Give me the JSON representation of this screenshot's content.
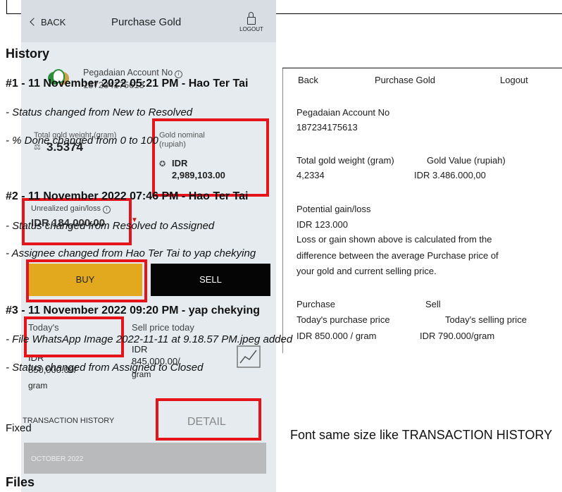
{
  "history_title": "History",
  "files_title": "Files",
  "fixed_note": "Fixed",
  "journal": [
    {
      "header": "#1 - 11 November 2022 05:21 PM - Hao Ter Tai",
      "details": [
        "- Status changed from New to Resolved",
        "- % Done changed from 0 to 100"
      ]
    },
    {
      "header": "#2 - 11 November 2022 07:46 PM - Hao Ter Tai",
      "details": [
        "- Status changed from Resolved to Assigned",
        "- Assignee changed from Hao Ter Tai to yap chekying"
      ]
    },
    {
      "header": "#3 - 11 November 2022 09:20 PM - yap chekying",
      "details": [
        "- File WhatsApp Image 2022-11-11 at 9.18.57 PM.jpeg added",
        "- Status changed from Assigned to Closed"
      ]
    }
  ],
  "phone": {
    "back": "BACK",
    "title": "Purchase Gold",
    "logout": "LOGOUT",
    "account_label": "Pegadaian Account No",
    "account_number": "187234175613",
    "gold_weight_label": "Total gold weight (gram)",
    "gold_weight_value": "3.5374",
    "gold_nominal_label": "Gold nominal (rupiah)",
    "gold_nominal_currency": "IDR",
    "gold_nominal_value": "2,989,103.00",
    "gain_label": "Unrealized gain/loss",
    "gain_value": "IDR 184,000.00",
    "buy": "BUY",
    "sell": "SELL",
    "today_label": "Today's",
    "sell_price_label": "Sell price today",
    "purchase_currency": "IDR",
    "purchase_value": "850,000.00/",
    "purchase_unit": "gram",
    "sell_currency": "IDR",
    "sell_value": "845,000.00/",
    "sell_unit": "gram",
    "tab_history": "TRANSACTION HISTORY",
    "tab_detail": "DETAIL",
    "month": "OCTOBER 2022"
  },
  "reference": {
    "back": "Back",
    "title": "Purchase Gold",
    "logout": "Logout",
    "account_label": "Pegadaian Account No",
    "account_number": "187234175613",
    "weight_label": "Total gold weight (gram)",
    "value_label": "Gold Value (rupiah)",
    "weight_value": "4,2334",
    "value_value": "IDR 3.486.000,00",
    "gain_label": "Potential gain/loss",
    "gain_value": "IDR 123.000",
    "note_line1": "Loss or gain shown above is calculated from the",
    "note_line2": "difference between the average Purchase price of",
    "note_line3": "your gold and current selling price.",
    "purchase_label": "Purchase",
    "sell_label": "Sell",
    "today_purchase_label": "Today's purchase price",
    "today_sell_label": "Today's selling price",
    "today_purchase_value": "IDR 850.000 / gram",
    "today_sell_value": "IDR 790.000/gram"
  },
  "font_note": "Font same size like TRANSACTION HISTORY"
}
